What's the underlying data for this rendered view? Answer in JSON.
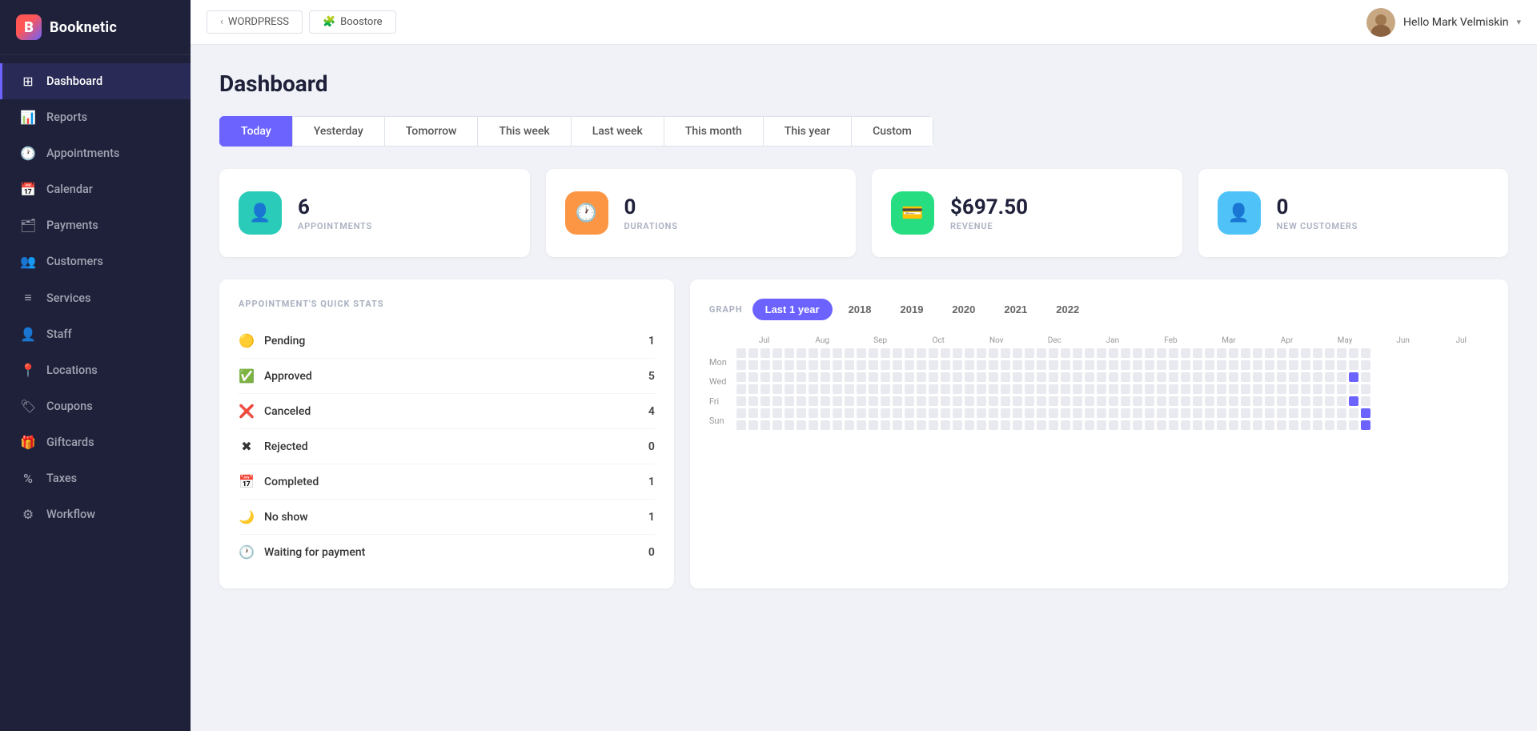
{
  "sidebar": {
    "logo_text": "Booknetic",
    "nav_items": [
      {
        "id": "dashboard",
        "label": "Dashboard",
        "icon": "⊞",
        "active": true
      },
      {
        "id": "reports",
        "label": "Reports",
        "icon": "📊",
        "active": false
      },
      {
        "id": "appointments",
        "label": "Appointments",
        "icon": "🕐",
        "active": false
      },
      {
        "id": "calendar",
        "label": "Calendar",
        "icon": "📅",
        "active": false
      },
      {
        "id": "payments",
        "label": "Payments",
        "icon": "🗂",
        "active": false
      },
      {
        "id": "customers",
        "label": "Customers",
        "icon": "👥",
        "active": false
      },
      {
        "id": "services",
        "label": "Services",
        "icon": "≡",
        "active": false
      },
      {
        "id": "staff",
        "label": "Staff",
        "icon": "👤",
        "active": false
      },
      {
        "id": "locations",
        "label": "Locations",
        "icon": "📍",
        "active": false
      },
      {
        "id": "coupons",
        "label": "Coupons",
        "icon": "🏷",
        "active": false
      },
      {
        "id": "giftcards",
        "label": "Giftcards",
        "icon": "🎁",
        "active": false
      },
      {
        "id": "taxes",
        "label": "Taxes",
        "icon": "%",
        "active": false
      },
      {
        "id": "workflow",
        "label": "Workflow",
        "icon": "⚙",
        "active": false
      }
    ]
  },
  "topbar": {
    "tabs": [
      {
        "label": "WORDPRESS",
        "icon": "‹"
      },
      {
        "label": "Boostore",
        "icon": "🧩"
      }
    ],
    "user_greeting": "Hello Mark Velmiskin",
    "user_name": "Mark Velmiskin"
  },
  "page": {
    "title": "Dashboard"
  },
  "time_tabs": [
    {
      "label": "Today",
      "active": true
    },
    {
      "label": "Yesterday",
      "active": false
    },
    {
      "label": "Tomorrow",
      "active": false
    },
    {
      "label": "This week",
      "active": false
    },
    {
      "label": "Last week",
      "active": false
    },
    {
      "label": "This month",
      "active": false
    },
    {
      "label": "This year",
      "active": false
    },
    {
      "label": "Custom",
      "active": false
    }
  ],
  "stats": [
    {
      "value": "6",
      "label": "APPOINTMENTS",
      "icon_type": "teal",
      "icon": "👤"
    },
    {
      "value": "0",
      "label": "DURATIONS",
      "icon_type": "orange",
      "icon": "🕐"
    },
    {
      "value": "$697.50",
      "label": "REVENUE",
      "icon_type": "green",
      "icon": "💳"
    },
    {
      "value": "0",
      "label": "NEW CUSTOMERS",
      "icon_type": "blue",
      "icon": "👤"
    }
  ],
  "quick_stats": {
    "title": "APPOINTMENT'S QUICK STATS",
    "items": [
      {
        "label": "Pending",
        "count": 1,
        "icon": "🟡",
        "icon_color": "#fd9644"
      },
      {
        "label": "Approved",
        "count": 5,
        "icon": "✅",
        "icon_color": "#26de81"
      },
      {
        "label": "Canceled",
        "count": 4,
        "icon": "❌",
        "icon_color": "#fc5c65"
      },
      {
        "label": "Rejected",
        "count": 0,
        "icon": "✖",
        "icon_color": "#aaa"
      },
      {
        "label": "Completed",
        "count": 1,
        "icon": "📅",
        "icon_color": "#6c63ff"
      },
      {
        "label": "No show",
        "count": 1,
        "icon": "🌙",
        "icon_color": "#fd9644"
      },
      {
        "label": "Waiting for payment",
        "count": 0,
        "icon": "🕐",
        "icon_color": "#fd9644"
      }
    ]
  },
  "graph": {
    "label": "GRAPH",
    "tabs": [
      {
        "label": "Last 1 year",
        "active": true
      },
      {
        "label": "2018",
        "active": false
      },
      {
        "label": "2019",
        "active": false
      },
      {
        "label": "2020",
        "active": false
      },
      {
        "label": "2021",
        "active": false
      },
      {
        "label": "2022",
        "active": false
      }
    ],
    "month_labels": [
      "Jul",
      "Aug",
      "Sep",
      "Oct",
      "Nov",
      "Dec",
      "Jan",
      "Feb",
      "Mar",
      "Apr",
      "May",
      "Jun",
      "Jul"
    ],
    "day_labels": [
      "Mon",
      "Wed",
      "Fri",
      "Sun"
    ],
    "cols": 53,
    "rows": 7,
    "active_cells": [
      {
        "col": 51,
        "row": 2
      },
      {
        "col": 51,
        "row": 4
      },
      {
        "col": 52,
        "row": 5
      },
      {
        "col": 52,
        "row": 6
      }
    ]
  }
}
